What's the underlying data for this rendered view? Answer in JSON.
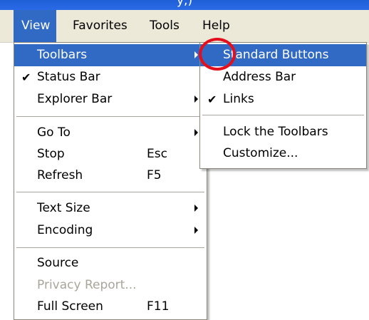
{
  "titlebar": {
    "partial_text": "y,)"
  },
  "menubar": {
    "items": [
      "View",
      "Favorites",
      "Tools",
      "Help"
    ]
  },
  "view_menu": {
    "items": [
      {
        "label": "Toolbars",
        "shortcut": "",
        "checked": false,
        "submenu": true,
        "disabled": false
      },
      {
        "label": "Status Bar",
        "shortcut": "",
        "checked": true,
        "submenu": false,
        "disabled": false
      },
      {
        "label": "Explorer Bar",
        "shortcut": "",
        "checked": false,
        "submenu": true,
        "disabled": false
      },
      {
        "label": "Go To",
        "shortcut": "",
        "checked": false,
        "submenu": true,
        "disabled": false
      },
      {
        "label": "Stop",
        "shortcut": "Esc",
        "checked": false,
        "submenu": false,
        "disabled": false
      },
      {
        "label": "Refresh",
        "shortcut": "F5",
        "checked": false,
        "submenu": false,
        "disabled": false
      },
      {
        "label": "Text Size",
        "shortcut": "",
        "checked": false,
        "submenu": true,
        "disabled": false
      },
      {
        "label": "Encoding",
        "shortcut": "",
        "checked": false,
        "submenu": true,
        "disabled": false
      },
      {
        "label": "Source",
        "shortcut": "",
        "checked": false,
        "submenu": false,
        "disabled": false
      },
      {
        "label": "Privacy Report...",
        "shortcut": "",
        "checked": false,
        "submenu": false,
        "disabled": true
      },
      {
        "label": "Full Screen",
        "shortcut": "F11",
        "checked": false,
        "submenu": false,
        "disabled": false
      }
    ]
  },
  "toolbars_submenu": {
    "items": [
      {
        "label": "Standard Buttons",
        "checked": false
      },
      {
        "label": "Address Bar",
        "checked": false
      },
      {
        "label": "Links",
        "checked": true
      },
      {
        "label": "Lock the Toolbars",
        "checked": false
      },
      {
        "label": "Customize...",
        "checked": false
      }
    ]
  },
  "glyphs": {
    "check": "✔"
  },
  "colors": {
    "highlight": "#316ac5",
    "annotation_circle": "#e40f1c",
    "menubar": "#ece9d8"
  }
}
